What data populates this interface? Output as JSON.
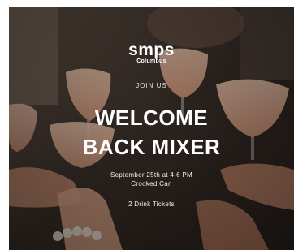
{
  "logo": {
    "brand": "smps",
    "sub": "Columbus"
  },
  "eyebrow": "JOIN US",
  "title_line1": "WELCOME",
  "title_line2": "BACK MIXER",
  "details": {
    "date_time": "September 25th at 4-6 PM",
    "venue": "Crooked Can",
    "tickets": "2 Drink Tickets"
  },
  "colors": {
    "text": "#ffffff",
    "drink": "#e8b49a",
    "background": "#2e2520"
  }
}
